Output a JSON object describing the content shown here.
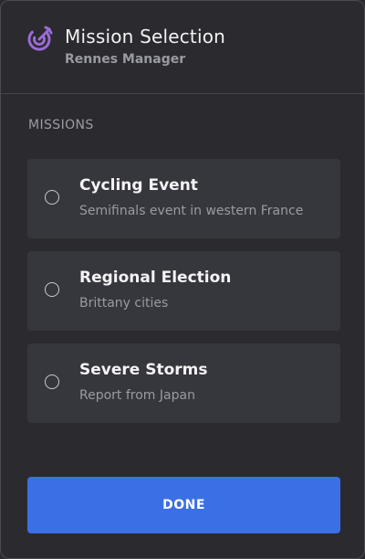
{
  "header": {
    "title": "Mission Selection",
    "subtitle": "Rennes Manager",
    "icon": "target-arrow-icon",
    "icon_color": "#9b6bd6"
  },
  "section": {
    "label": "MISSIONS"
  },
  "missions": [
    {
      "title": "Cycling Event",
      "description": "Semifinals event in western France",
      "selected": false
    },
    {
      "title": "Regional Election",
      "description": "Brittany cities",
      "selected": false
    },
    {
      "title": "Severe Storms",
      "description": "Report from Japan",
      "selected": false
    }
  ],
  "done_button": {
    "label": "DONE",
    "color": "#3b6fe5"
  }
}
